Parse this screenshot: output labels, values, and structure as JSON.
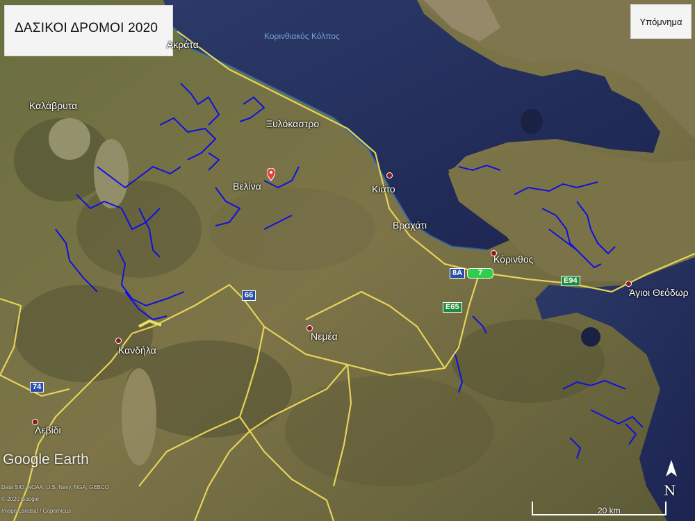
{
  "map": {
    "title": "ΔΑΣΙΚΟΙ ΔΡΟΜΟΙ 2020",
    "legend_button": "Υπόμνημα",
    "sea_label": "Κορινθιακός Κόλπος",
    "places": {
      "krata": "Ακράτα",
      "kalavryta": "Καλάβρυτα",
      "xylokastro": "Ξυλόκαστρο",
      "velina": "Βελίνα",
      "kiato": "Κιάτο",
      "vrachati": "Βραχάτι",
      "korinthos": "Κόρινθος",
      "agioi_theodoroi": "Άγιοι Θεόδωρ",
      "nemea": "Νεμέα",
      "kandila": "Κανδήλα",
      "levidi": "Λεβίδι"
    },
    "road_shields": {
      "r66": "66",
      "r74": "74",
      "r8a": "8A",
      "e65": "E65",
      "e94": "E94",
      "r7": "7"
    },
    "watermark": "Google Earth",
    "credits": [
      "Data SIO, NOAA, U.S. Navy, NGA, GEBCO",
      "© 2020 Google",
      "Image Landsat / Copernicus"
    ],
    "scale_label": "20 km",
    "north_label": "N",
    "colors": {
      "forest_roads": "#1010e0",
      "main_roads": "#e6d35a",
      "sea": "#23305a",
      "land": "#5b6a3a"
    }
  }
}
